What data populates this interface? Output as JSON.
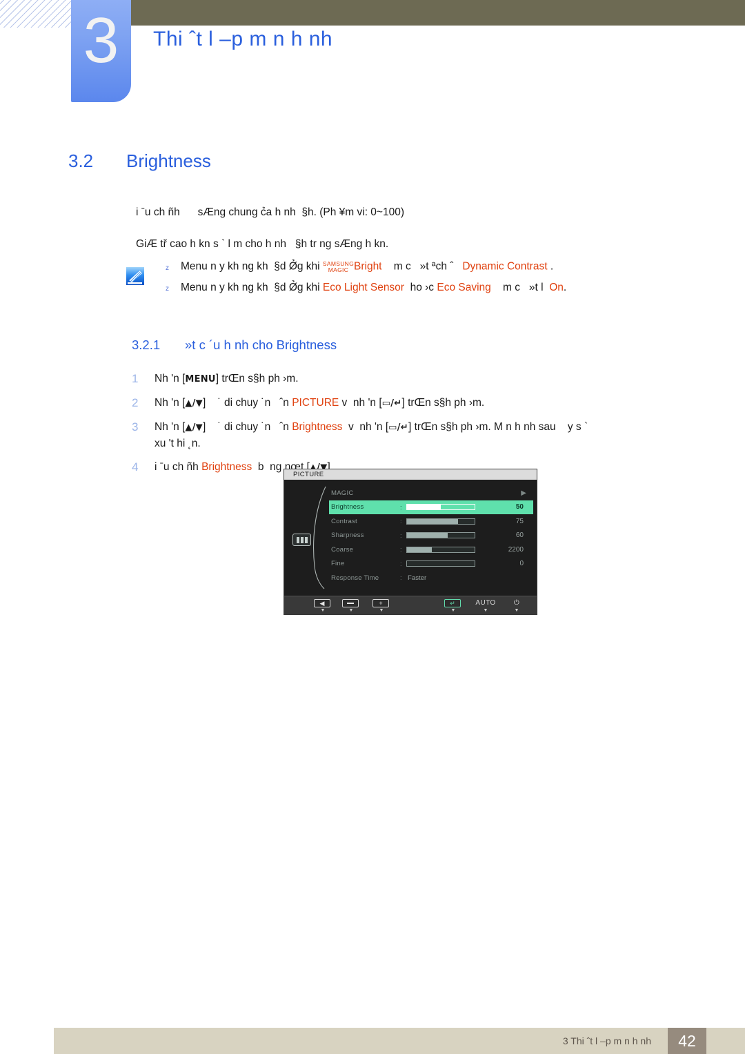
{
  "header": {
    "chapter_number": "3",
    "chapter_title": "Thi ˆt l –p m n h nh",
    "accent_blue": "#2a5fdd",
    "olive": "#6d6a53"
  },
  "section": {
    "number": "3.2",
    "title": "Brightness",
    "paragraph_range": "i ˉu ch ñh      sÆng chung c̉a h nh  §h. (Ph ¥m vi: 0~100)",
    "paragraph_desc": "GiÆ tř cao h kn s ` l m cho h nh   §h tr ng sÆng h kn."
  },
  "note": {
    "icon_name": "note-pencil-icon",
    "marker": "z",
    "lines": [
      {
        "parts": [
          {
            "t": "Menu n y kh ng kh  §d Ø̉g khi ",
            "c": "plain"
          },
          {
            "t": "SAMSUNG\nMAGIC",
            "c": "samsungmagic"
          },
          {
            "t": "Bright",
            "c": "hl"
          },
          {
            "t": "    m c   »t ªch ˆ   ",
            "c": "plain"
          },
          {
            "t": "Dynamic Contrast",
            "c": "hl"
          },
          {
            "t": " .",
            "c": "plain"
          }
        ]
      },
      {
        "parts": [
          {
            "t": "Menu n y kh ng kh  §d Ø̉g khi ",
            "c": "plain"
          },
          {
            "t": "Eco Light Sensor",
            "c": "hl"
          },
          {
            "t": "  ho ›c ",
            "c": "plain"
          },
          {
            "t": "Eco Saving",
            "c": "hl"
          },
          {
            "t": "    m c   »t l  ",
            "c": "plain"
          },
          {
            "t": "On",
            "c": "hl"
          },
          {
            "t": ".",
            "c": "plain"
          }
        ]
      }
    ]
  },
  "subsection": {
    "number": "3.2.1",
    "title": "»t c ´u h nh cho Brightness"
  },
  "steps": [
    {
      "num": "1",
      "parts": [
        {
          "t": "Nh 'n [",
          "c": "plain"
        },
        {
          "t": "MENU",
          "c": "kbd"
        },
        {
          "t": "] trŒn s§h ph ›m.",
          "c": "plain"
        }
      ]
    },
    {
      "num": "2",
      "parts": [
        {
          "t": "Nh 'n [",
          "c": "plain"
        },
        {
          "t": "▲/▼",
          "c": "kbd"
        },
        {
          "t": "]    ˙ di chuy ˙n   ˆn ",
          "c": "plain"
        },
        {
          "t": "PICTURE",
          "c": "hl"
        },
        {
          "t": " v  nh 'n [",
          "c": "plain"
        },
        {
          "t": "▭/↵",
          "c": "kbd"
        },
        {
          "t": "] trŒn s§h ph ›m.",
          "c": "plain"
        }
      ]
    },
    {
      "num": "3",
      "parts": [
        {
          "t": "Nh 'n [",
          "c": "plain"
        },
        {
          "t": "▲/▼",
          "c": "kbd"
        },
        {
          "t": "]    ˙ di chuy ˙n   ˆn ",
          "c": "plain"
        },
        {
          "t": "Brightness",
          "c": "hl"
        },
        {
          "t": "  v  nh 'n [",
          "c": "plain"
        },
        {
          "t": "▭/↵",
          "c": "kbd"
        },
        {
          "t": "] trŒn s§h ph ›m. M n h nh sau    y s `\nxu 't hi ˛n.",
          "c": "plain"
        }
      ]
    },
    {
      "num": "4",
      "parts": [
        {
          "t": "i ˉu ch ñh ",
          "c": "plain"
        },
        {
          "t": "Brightness",
          "c": "hl"
        },
        {
          "t": "  b  ng nœt [",
          "c": "plain"
        },
        {
          "t": "▲/▼",
          "c": "kbd"
        },
        {
          "t": "].",
          "c": "plain"
        }
      ]
    }
  ],
  "osd": {
    "title": "PICTURE",
    "side_icon": "picture-bars-icon",
    "rows": [
      {
        "label": "MAGIC",
        "kind": "arrow",
        "arrow": "▶",
        "selected": false
      },
      {
        "label": "Brightness",
        "kind": "slider",
        "value": "50",
        "fill": 50,
        "selected": true
      },
      {
        "label": "Contrast",
        "kind": "slider",
        "value": "75",
        "fill": 75,
        "selected": false
      },
      {
        "label": "Sharpness",
        "kind": "slider",
        "value": "60",
        "fill": 60,
        "selected": false
      },
      {
        "label": "Coarse",
        "kind": "slider",
        "value": "2200",
        "fill": 37,
        "selected": false
      },
      {
        "label": "Fine",
        "kind": "slider",
        "value": "0",
        "fill": 0,
        "selected": false
      },
      {
        "label": "Response Time",
        "kind": "text",
        "value": "Faster",
        "selected": false
      }
    ],
    "toolbar": [
      {
        "name": "back-button",
        "glyph": "◀",
        "type": "key",
        "tick": "▼"
      },
      {
        "name": "minus-button",
        "glyph": "−",
        "type": "dash",
        "tick": "▼"
      },
      {
        "name": "plus-button",
        "glyph": "+",
        "type": "key",
        "tick": "▼"
      },
      {
        "name": "enter-button",
        "glyph": "↵",
        "type": "key-green",
        "tick": "▼"
      },
      {
        "name": "auto-button",
        "glyph": "AUTO",
        "type": "cap",
        "tick": "▼"
      },
      {
        "name": "power-button",
        "glyph": "⏻",
        "type": "cap",
        "tick": "▼"
      }
    ],
    "highlight_color": "#5fe0ac"
  },
  "footer": {
    "text": "3 Thi ˆt l –p m n h nh",
    "page": "42",
    "bar_color": "#d8d3c1",
    "page_box_color": "#968b7e"
  }
}
